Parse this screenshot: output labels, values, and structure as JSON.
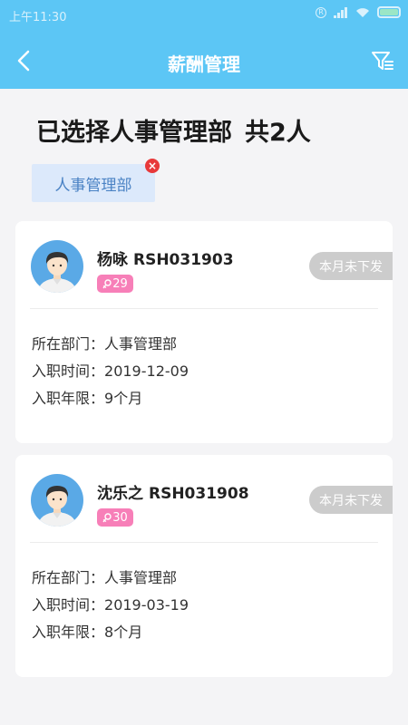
{
  "status_bar": {
    "time": "上午11:30",
    "r_mark": "R"
  },
  "header": {
    "title": "薪酬管理"
  },
  "summary": {
    "prefix": "已选择人事管理部",
    "count": "共2人"
  },
  "filter_chip": {
    "label": "人事管理部",
    "remove": "×"
  },
  "labels": {
    "dept": "所在部门：",
    "hire_date": "入职时间：",
    "tenure": "入职年限："
  },
  "employees": [
    {
      "name": "杨咏",
      "code": "RSH031903",
      "age": "29",
      "status": "本月未下发",
      "dept": "人事管理部",
      "hire_date": "2019-12-09",
      "tenure": "9个月"
    },
    {
      "name": "沈乐之",
      "code": "RSH031908",
      "age": "30",
      "status": "本月未下发",
      "dept": "人事管理部",
      "hire_date": "2019-03-19",
      "tenure": "8个月"
    }
  ],
  "colors": {
    "header_bg": "#5cc6f5",
    "age_badge": "#f77fb8",
    "chip_bg": "#dce9fb",
    "chip_text": "#4a82c4",
    "remove_red": "#e8393a",
    "status_pill": "#cccccc"
  }
}
